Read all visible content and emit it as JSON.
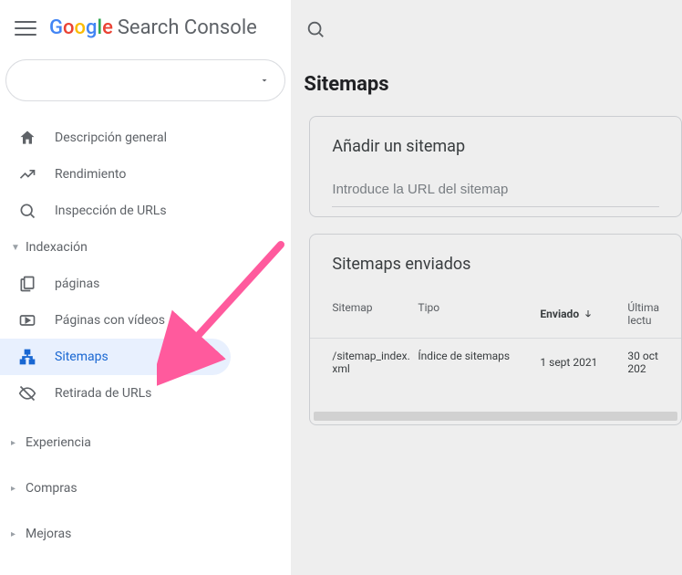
{
  "app": {
    "logo_text": "Search Console"
  },
  "sidebar": {
    "items": [
      {
        "label": "Descripción general"
      },
      {
        "label": "Rendimiento"
      },
      {
        "label": "Inspección de URLs"
      }
    ],
    "section_index": "Indexación",
    "index_items": [
      {
        "label": "páginas"
      },
      {
        "label": "Páginas con vídeos"
      },
      {
        "label": "Sitemaps"
      },
      {
        "label": "Retirada de URLs"
      }
    ],
    "section_experience": "Experiencia",
    "section_shopping": "Compras",
    "section_improve": "Mejoras"
  },
  "main": {
    "page_title": "Sitemaps",
    "add_card": {
      "title": "Añadir un sitemap",
      "placeholder": "Introduce la URL del sitemap"
    },
    "sent_card": {
      "title": "Sitemaps enviados",
      "columns": {
        "sitemap": "Sitemap",
        "type": "Tipo",
        "sent": "Enviado",
        "last": "Última lectu"
      },
      "rows": [
        {
          "sitemap": "/sitemap_index.xml",
          "type": "Índice de sitemaps",
          "sent": "1 sept 2021",
          "last": "30 oct 202"
        }
      ]
    }
  }
}
